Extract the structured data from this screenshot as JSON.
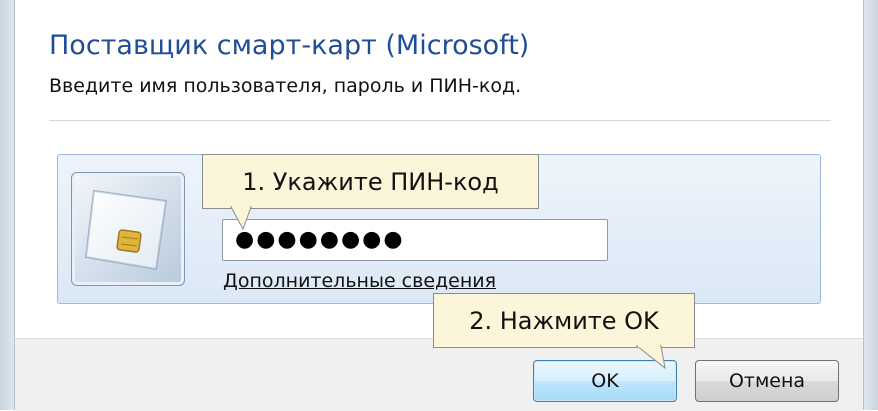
{
  "dialog": {
    "title": "Поставщик смарт-карт (Microsoft)",
    "subtitle": "Введите имя пользователя, пароль и ПИН-код."
  },
  "credential": {
    "card_icon": "smart-card-icon",
    "pin_value": "●●●●●●●●",
    "more_info_link": "Дополнительные сведения"
  },
  "buttons": {
    "ok": "OK",
    "cancel": "Отмена"
  },
  "annotations": {
    "step1": "1. Укажите ПИН-код",
    "step2": "2. Нажмите OK"
  },
  "colors": {
    "title": "#1f4e96",
    "callout_bg": "#fbf6d9",
    "panel_border": "#9fbbdc"
  }
}
